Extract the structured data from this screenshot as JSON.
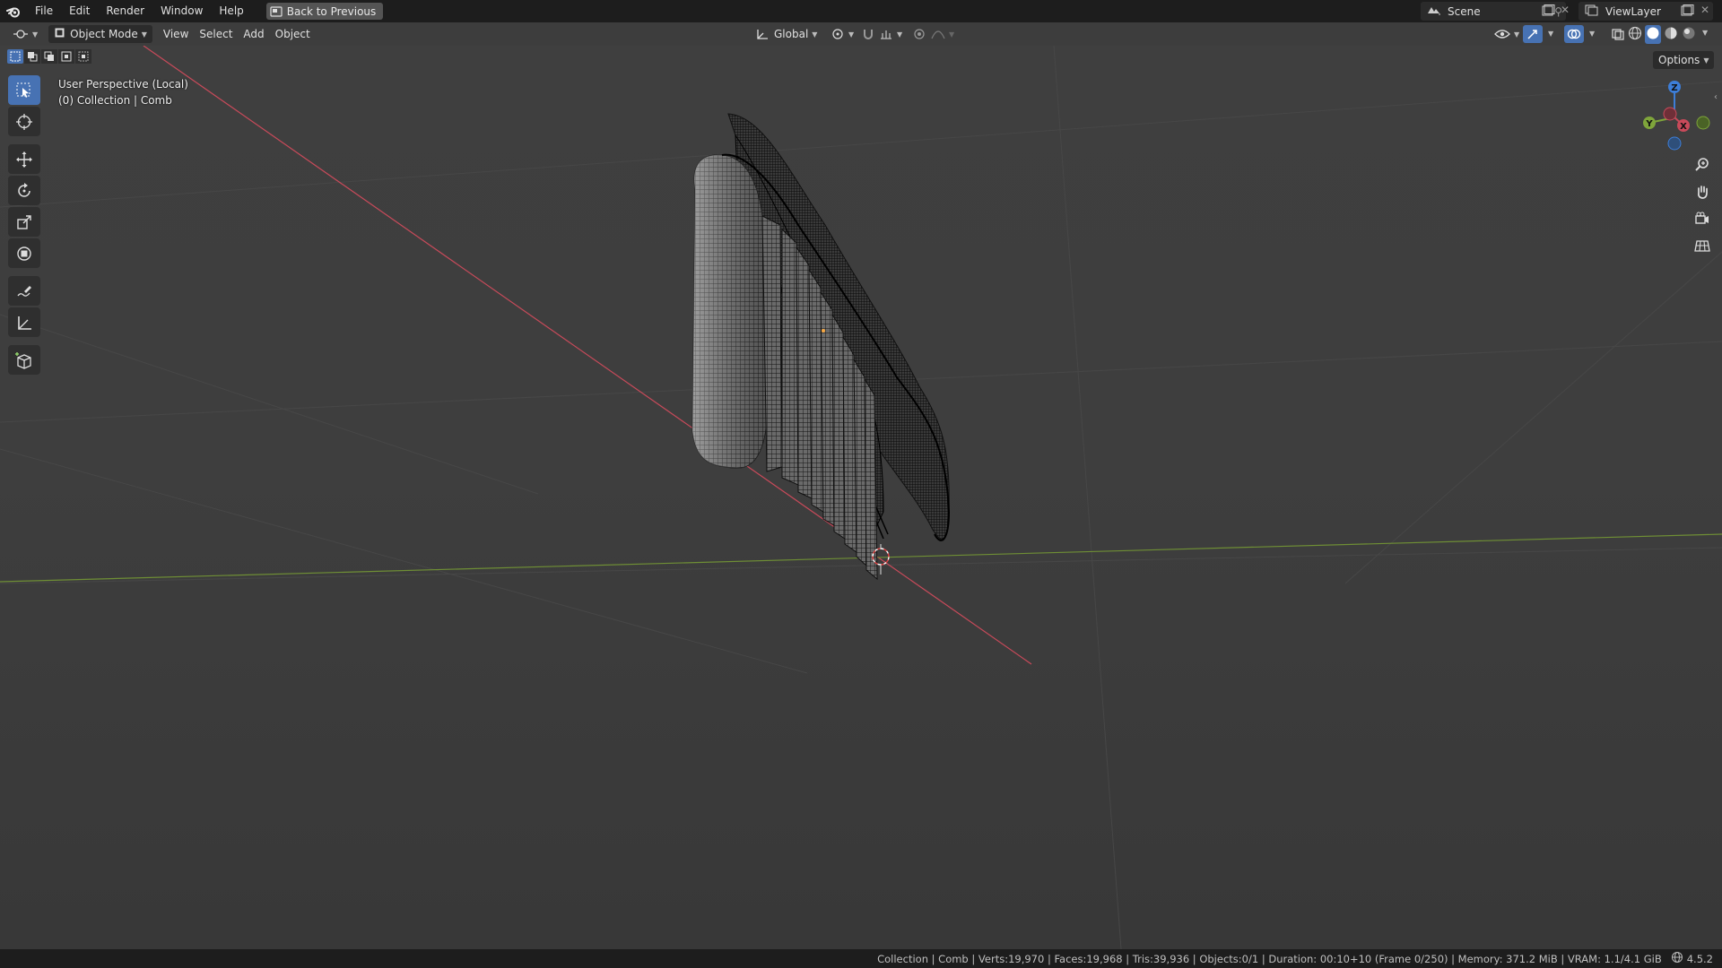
{
  "menu": {
    "items": [
      "File",
      "Edit",
      "Render",
      "Window",
      "Help"
    ],
    "back_button": "Back to Previous"
  },
  "workspace": {
    "scene_label": "Scene",
    "view_layer_label": "ViewLayer"
  },
  "header": {
    "mode": "Object Mode",
    "menus": [
      "View",
      "Select",
      "Add",
      "Object"
    ],
    "transform_orientation": "Global",
    "options_label": "Options"
  },
  "viewport": {
    "perspective_label": "User Perspective (Local)",
    "collection_label": "(0) Collection | Comb",
    "gizmo_axes": {
      "x": "X",
      "y": "Y",
      "z": "Z"
    }
  },
  "toolbar": {
    "tools": [
      "select-box",
      "cursor",
      "move",
      "rotate",
      "scale",
      "transform",
      "annotate",
      "measure",
      "add-cube"
    ],
    "active": "select-box"
  },
  "statusbar": {
    "text": "Collection | Comb | Verts:19,970 | Faces:19,968 | Tris:39,936 | Objects:0/1 | Duration: 00:10+10 (Frame 0/250) | Memory: 371.2 MiB | VRAM: 1.1/4.1 GiB",
    "version": "4.5.2"
  },
  "colors": {
    "menu_bg": "#1d1d1d",
    "viewport_bg": "#3d3d3d",
    "accent": "#4772b3",
    "x_axis": "#c84a5a",
    "y_axis": "#7fa53b",
    "z_axis": "#3d7ed8"
  }
}
